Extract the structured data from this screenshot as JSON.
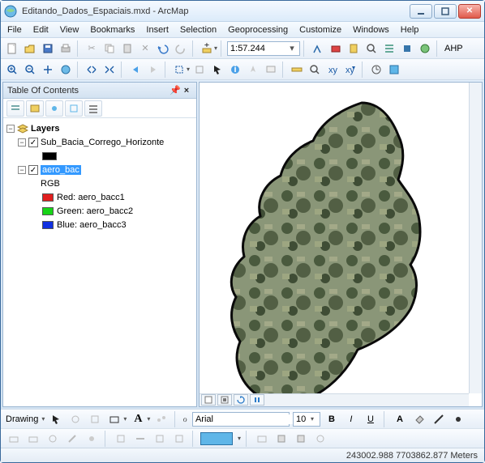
{
  "window": {
    "title": "Editando_Dados_Espaciais.mxd - ArcMap"
  },
  "menu": {
    "file": "File",
    "edit": "Edit",
    "view": "View",
    "bookmarks": "Bookmarks",
    "insert": "Insert",
    "selection": "Selection",
    "geoprocessing": "Geoprocessing",
    "customize": "Customize",
    "windows": "Windows",
    "help": "Help"
  },
  "toolbar": {
    "scale": "1:57.244",
    "ahp": "AHP"
  },
  "toc": {
    "title": "Table Of Contents",
    "root": "Layers",
    "layer1": {
      "name": "Sub_Bacia_Corrego_Horizonte"
    },
    "layer2": {
      "name": "aero_bac",
      "rgb": "RGB",
      "red": "Red:   aero_bacc1",
      "green": "Green: aero_bacc2",
      "blue": "Blue:  aero_bacc3"
    }
  },
  "drawing": {
    "label": "Drawing",
    "font": "Arial",
    "size": "10",
    "bold": "B",
    "italic": "I",
    "underline": "U"
  },
  "status": {
    "coords": "243002.988 7703862.877 Meters"
  },
  "colors": {
    "red": "#e11f1f",
    "green": "#17d417",
    "blue": "#1030e0",
    "selection": "#3399ff",
    "accent": "#5fb6e8"
  }
}
